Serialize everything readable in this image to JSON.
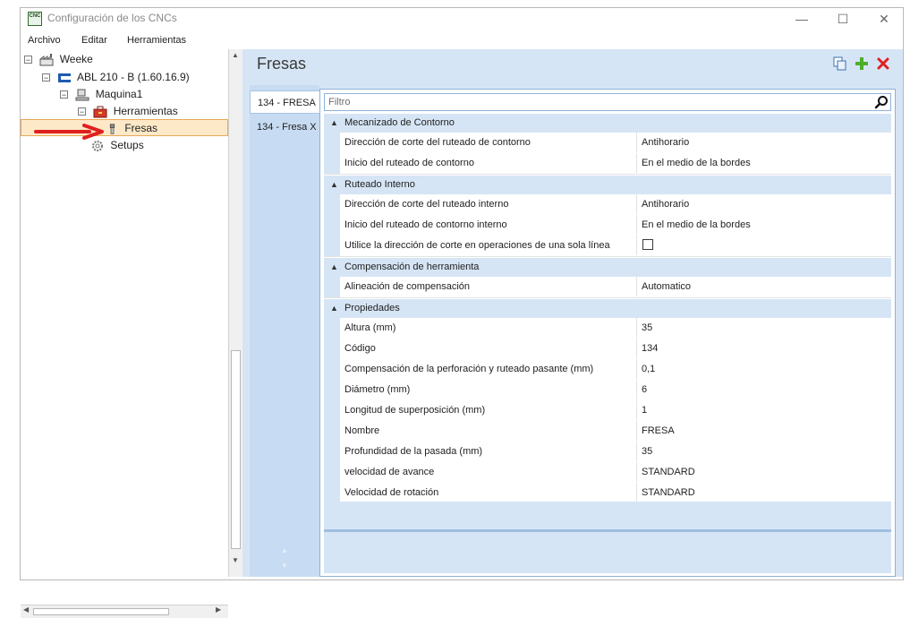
{
  "window": {
    "title": "Configuración de los CNCs",
    "app_icon_text": "CNC",
    "controls": {
      "minimize": "—",
      "maximize": "☐",
      "close": "✕"
    }
  },
  "menubar": [
    "Archivo",
    "Editar",
    "Herramientas"
  ],
  "tree": {
    "root": "Weeke",
    "machine": "ABL 210 - B (1.60.16.9)",
    "maquina": "Maquina1",
    "herramientas": "Herramientas",
    "fresas": "Fresas",
    "setups": "Setups",
    "selected": "Fresas"
  },
  "header": {
    "title": "Fresas",
    "icons": [
      "copy-icon",
      "add-icon",
      "delete-icon"
    ]
  },
  "tabs": [
    "134 - FRESA",
    "134 - Fresa X"
  ],
  "filter": {
    "placeholder": "Filtro"
  },
  "groups": [
    {
      "label": "Mecanizado de Contorno",
      "rows": [
        {
          "name": "Dirección de corte del ruteado de contorno",
          "value": "Antihorario"
        },
        {
          "name": "Inicio del ruteado de contorno",
          "value": "En el medio de la bordes"
        }
      ]
    },
    {
      "label": "Ruteado Interno",
      "rows": [
        {
          "name": "Dirección de corte del ruteado interno",
          "value": "Antihorario"
        },
        {
          "name": "Inicio del ruteado de contorno interno",
          "value": "En el medio de la bordes"
        },
        {
          "name": "Utilice la dirección de corte en operaciones de una sola línea",
          "value": "",
          "checkbox": false
        }
      ]
    },
    {
      "label": "Compensación de herramienta",
      "rows": [
        {
          "name": "Alineación de compensación",
          "value": "Automatico"
        }
      ]
    },
    {
      "label": "Propiedades",
      "rows": [
        {
          "name": "Altura (mm)",
          "value": "35"
        },
        {
          "name": "Código",
          "value": "134"
        },
        {
          "name": "Compensación de la perforación y ruteado pasante (mm)",
          "value": "0,1"
        },
        {
          "name": "Diámetro (mm)",
          "value": "6"
        },
        {
          "name": "Longitud de superposición (mm)",
          "value": "1"
        },
        {
          "name": "Nombre",
          "value": "FRESA"
        },
        {
          "name": "Profundidad de la pasada (mm)",
          "value": "35"
        },
        {
          "name": "velocidad de avance",
          "value": "STANDARD"
        },
        {
          "name": "Velocidad de rotación",
          "value": "STANDARD"
        }
      ]
    }
  ],
  "colors": {
    "accent_bg": "#d6e5f5",
    "selection": "#fde9c8",
    "arrow": "#e02020"
  }
}
